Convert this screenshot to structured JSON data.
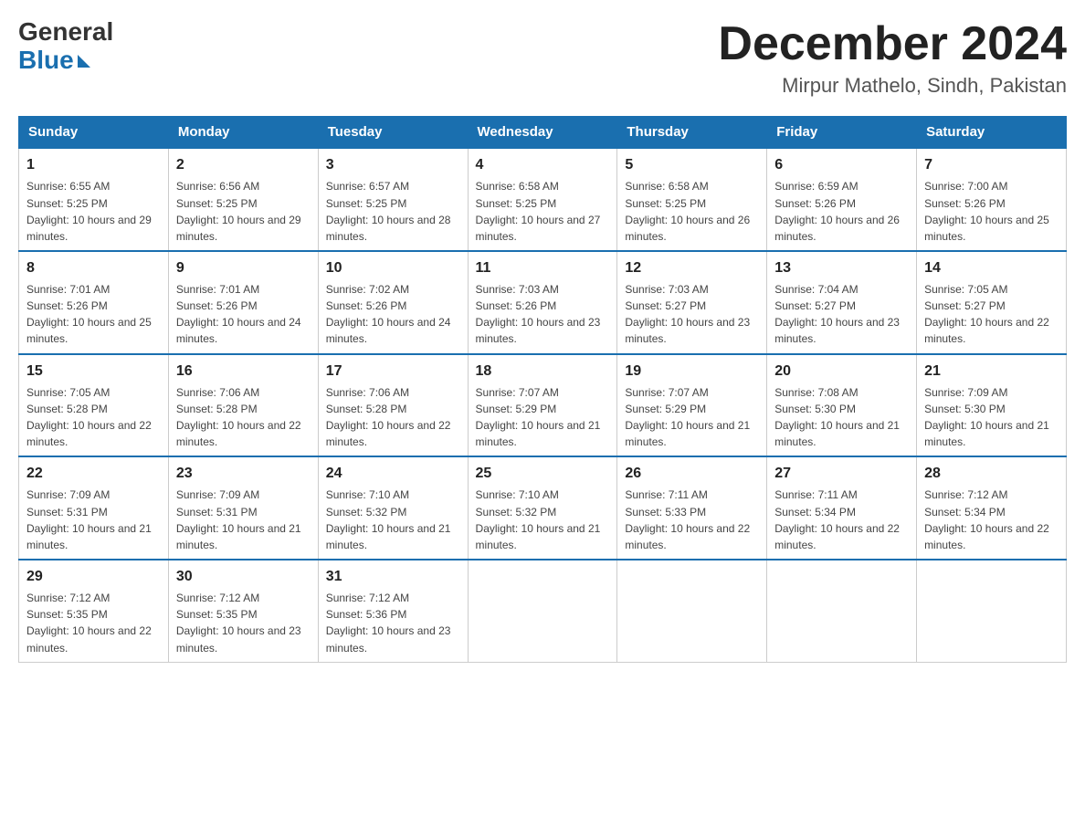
{
  "header": {
    "logo": {
      "general": "General",
      "blue": "Blue"
    },
    "title": "December 2024",
    "location": "Mirpur Mathelo, Sindh, Pakistan"
  },
  "days_of_week": [
    "Sunday",
    "Monday",
    "Tuesday",
    "Wednesday",
    "Thursday",
    "Friday",
    "Saturday"
  ],
  "weeks": [
    [
      {
        "day": "1",
        "sunrise": "6:55 AM",
        "sunset": "5:25 PM",
        "daylight": "10 hours and 29 minutes."
      },
      {
        "day": "2",
        "sunrise": "6:56 AM",
        "sunset": "5:25 PM",
        "daylight": "10 hours and 29 minutes."
      },
      {
        "day": "3",
        "sunrise": "6:57 AM",
        "sunset": "5:25 PM",
        "daylight": "10 hours and 28 minutes."
      },
      {
        "day": "4",
        "sunrise": "6:58 AM",
        "sunset": "5:25 PM",
        "daylight": "10 hours and 27 minutes."
      },
      {
        "day": "5",
        "sunrise": "6:58 AM",
        "sunset": "5:25 PM",
        "daylight": "10 hours and 26 minutes."
      },
      {
        "day": "6",
        "sunrise": "6:59 AM",
        "sunset": "5:26 PM",
        "daylight": "10 hours and 26 minutes."
      },
      {
        "day": "7",
        "sunrise": "7:00 AM",
        "sunset": "5:26 PM",
        "daylight": "10 hours and 25 minutes."
      }
    ],
    [
      {
        "day": "8",
        "sunrise": "7:01 AM",
        "sunset": "5:26 PM",
        "daylight": "10 hours and 25 minutes."
      },
      {
        "day": "9",
        "sunrise": "7:01 AM",
        "sunset": "5:26 PM",
        "daylight": "10 hours and 24 minutes."
      },
      {
        "day": "10",
        "sunrise": "7:02 AM",
        "sunset": "5:26 PM",
        "daylight": "10 hours and 24 minutes."
      },
      {
        "day": "11",
        "sunrise": "7:03 AM",
        "sunset": "5:26 PM",
        "daylight": "10 hours and 23 minutes."
      },
      {
        "day": "12",
        "sunrise": "7:03 AM",
        "sunset": "5:27 PM",
        "daylight": "10 hours and 23 minutes."
      },
      {
        "day": "13",
        "sunrise": "7:04 AM",
        "sunset": "5:27 PM",
        "daylight": "10 hours and 23 minutes."
      },
      {
        "day": "14",
        "sunrise": "7:05 AM",
        "sunset": "5:27 PM",
        "daylight": "10 hours and 22 minutes."
      }
    ],
    [
      {
        "day": "15",
        "sunrise": "7:05 AM",
        "sunset": "5:28 PM",
        "daylight": "10 hours and 22 minutes."
      },
      {
        "day": "16",
        "sunrise": "7:06 AM",
        "sunset": "5:28 PM",
        "daylight": "10 hours and 22 minutes."
      },
      {
        "day": "17",
        "sunrise": "7:06 AM",
        "sunset": "5:28 PM",
        "daylight": "10 hours and 22 minutes."
      },
      {
        "day": "18",
        "sunrise": "7:07 AM",
        "sunset": "5:29 PM",
        "daylight": "10 hours and 21 minutes."
      },
      {
        "day": "19",
        "sunrise": "7:07 AM",
        "sunset": "5:29 PM",
        "daylight": "10 hours and 21 minutes."
      },
      {
        "day": "20",
        "sunrise": "7:08 AM",
        "sunset": "5:30 PM",
        "daylight": "10 hours and 21 minutes."
      },
      {
        "day": "21",
        "sunrise": "7:09 AM",
        "sunset": "5:30 PM",
        "daylight": "10 hours and 21 minutes."
      }
    ],
    [
      {
        "day": "22",
        "sunrise": "7:09 AM",
        "sunset": "5:31 PM",
        "daylight": "10 hours and 21 minutes."
      },
      {
        "day": "23",
        "sunrise": "7:09 AM",
        "sunset": "5:31 PM",
        "daylight": "10 hours and 21 minutes."
      },
      {
        "day": "24",
        "sunrise": "7:10 AM",
        "sunset": "5:32 PM",
        "daylight": "10 hours and 21 minutes."
      },
      {
        "day": "25",
        "sunrise": "7:10 AM",
        "sunset": "5:32 PM",
        "daylight": "10 hours and 21 minutes."
      },
      {
        "day": "26",
        "sunrise": "7:11 AM",
        "sunset": "5:33 PM",
        "daylight": "10 hours and 22 minutes."
      },
      {
        "day": "27",
        "sunrise": "7:11 AM",
        "sunset": "5:34 PM",
        "daylight": "10 hours and 22 minutes."
      },
      {
        "day": "28",
        "sunrise": "7:12 AM",
        "sunset": "5:34 PM",
        "daylight": "10 hours and 22 minutes."
      }
    ],
    [
      {
        "day": "29",
        "sunrise": "7:12 AM",
        "sunset": "5:35 PM",
        "daylight": "10 hours and 22 minutes."
      },
      {
        "day": "30",
        "sunrise": "7:12 AM",
        "sunset": "5:35 PM",
        "daylight": "10 hours and 23 minutes."
      },
      {
        "day": "31",
        "sunrise": "7:12 AM",
        "sunset": "5:36 PM",
        "daylight": "10 hours and 23 minutes."
      },
      null,
      null,
      null,
      null
    ]
  ],
  "labels": {
    "sunrise": "Sunrise:",
    "sunset": "Sunset:",
    "daylight": "Daylight:"
  }
}
